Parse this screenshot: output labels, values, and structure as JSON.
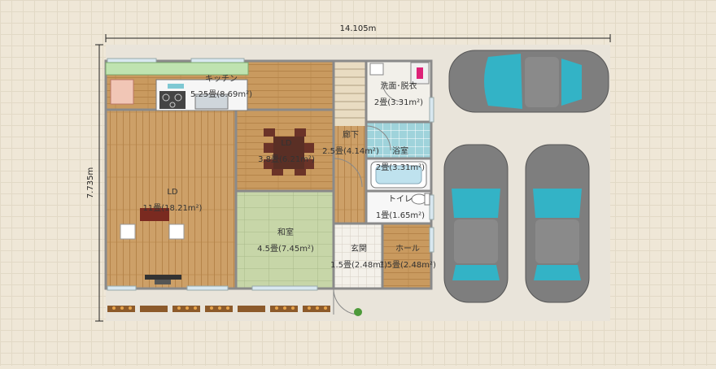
{
  "dimensions": {
    "width": "14.105m",
    "height": "7.735m"
  },
  "rooms": {
    "kitchen": {
      "name": "キッチン",
      "area": "5.25畳(8.69m²)"
    },
    "ld_center": {
      "name": "LD",
      "area": "3.8畳(6.21m²)"
    },
    "ld_main": {
      "name": "LD",
      "area": "11畳(18.21m²)"
    },
    "washitsu": {
      "name": "和室",
      "area": "4.5畳(7.45m²)"
    },
    "senmen": {
      "name": "洗面･脱衣",
      "area": "2畳(3.31m²)"
    },
    "rouka": {
      "name": "廊下",
      "area": "2.5畳(4.14m²)"
    },
    "yokushitsu": {
      "name": "浴室",
      "area": "2畳(3.31m²)"
    },
    "toilet": {
      "name": "トイレ",
      "area": "1畳(1.65m²)"
    },
    "genkan": {
      "name": "玄関",
      "area": "1.5畳(2.48m²)"
    },
    "hall": {
      "name": "ホール",
      "area": "1.5畳(2.48m²)"
    }
  },
  "colors": {
    "wood_floor": "#c99a5f",
    "wood_line": "#b5844a",
    "tatami": "#c7d6a8",
    "tile_blue": "#9fd3db",
    "wall": "#8a8a8a",
    "car_body": "#7e7e7e",
    "car_glass": "#33b3c6",
    "ground": "#e9e4da"
  }
}
